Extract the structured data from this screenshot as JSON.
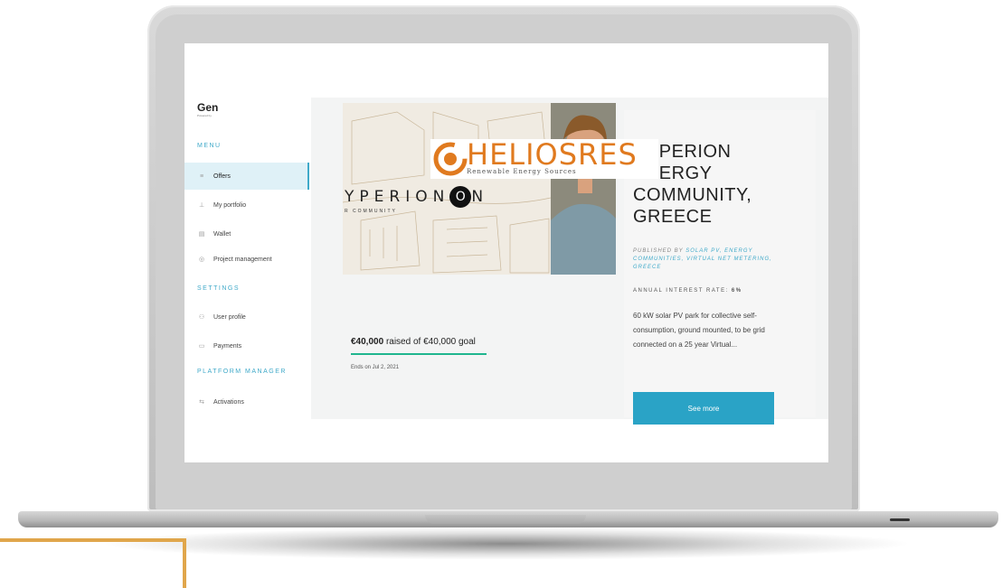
{
  "sidebar": {
    "brand": "Gen",
    "brand_sub": "Powered by",
    "sections": {
      "menu": "MENU",
      "settings": "SETTINGS",
      "platform_manager": "PLATFORM MANAGER"
    },
    "items": [
      {
        "label": "Offers",
        "icon": "offers-icon",
        "active": true
      },
      {
        "label": "My portfolio",
        "icon": "portfolio-icon"
      },
      {
        "label": "Wallet",
        "icon": "wallet-icon"
      },
      {
        "label": "Project management",
        "icon": "project-icon"
      },
      {
        "label": "User profile",
        "icon": "user-icon"
      },
      {
        "label": "Payments",
        "icon": "payments-icon"
      },
      {
        "label": "Activations",
        "icon": "activations-icon"
      }
    ]
  },
  "logo": {
    "text": "HELIOSRES",
    "subtitle": "Renewable Energy Sources",
    "color": "#e07a1f"
  },
  "offer": {
    "hero_text": "PERION",
    "hero_y": "Y",
    "hero_o": "O",
    "hero_n": "N",
    "hero_sub": "R COMMUNITY",
    "raised_amount": "€40,000",
    "raised_rest": "raised of €40,000 goal",
    "progress": 1.0,
    "ends": "Ends on Jul 2, 2021",
    "title": "HYPERION ENERGY COMMUNITY, GREECE",
    "published_by_label": "PUBLISHED BY",
    "published_by_value": "SOLAR PV, ENERGY COMMUNITIES, VIRTUAL NET METERING, GREECE",
    "interest_rate_label": "ANNUAL INTEREST RATE:",
    "interest_rate_value": "6%",
    "description": "60 kW solar PV park for collective self-consumption, ground mounted, to be grid connected on a 25 year Virtual...",
    "see_more": "See more"
  },
  "colors": {
    "accent": "#3fa9c9",
    "button": "#2aa3c6",
    "progress": "#1fb58e",
    "corner": "#e0a64b"
  }
}
